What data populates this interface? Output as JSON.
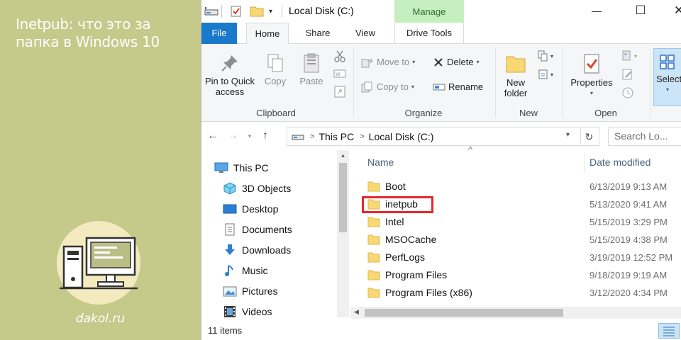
{
  "promo": {
    "title": "Inetpub: что это за папка в Windows 10",
    "site": "dakol.ru"
  },
  "window": {
    "title": "Local Disk (C:)",
    "context_tab": "Manage",
    "controls": {
      "minimize": "—",
      "maximize": "☐",
      "close": "✕"
    }
  },
  "tabs": [
    "File",
    "Home",
    "Share",
    "View",
    "Drive Tools"
  ],
  "ribbon": {
    "clipboard": {
      "label": "Clipboard",
      "pin": "Pin to Quick access",
      "copy": "Copy",
      "paste": "Paste"
    },
    "organize": {
      "label": "Organize",
      "move_to": "Move to",
      "copy_to": "Copy to",
      "delete": "Delete",
      "rename": "Rename"
    },
    "new": {
      "label": "New",
      "new_folder": "New folder"
    },
    "open": {
      "label": "Open",
      "properties": "Properties"
    },
    "select": {
      "select": "Select"
    }
  },
  "address": {
    "crumbs": [
      "This PC",
      "Local Disk (C:)"
    ],
    "search_placeholder": "Search Lo..."
  },
  "nav": [
    {
      "label": "This PC",
      "icon": "computer-icon"
    },
    {
      "label": "3D Objects",
      "icon": "cube-icon"
    },
    {
      "label": "Desktop",
      "icon": "desktop-icon"
    },
    {
      "label": "Documents",
      "icon": "document-icon"
    },
    {
      "label": "Downloads",
      "icon": "download-arrow-icon"
    },
    {
      "label": "Music",
      "icon": "music-note-icon"
    },
    {
      "label": "Pictures",
      "icon": "picture-icon"
    },
    {
      "label": "Videos",
      "icon": "film-icon"
    }
  ],
  "columns": {
    "name": "Name",
    "date": "Date modified"
  },
  "files": [
    {
      "name": "Boot",
      "date": "6/13/2019 9:13 AM"
    },
    {
      "name": "inetpub",
      "date": "5/13/2020 9:41 AM",
      "highlighted": true
    },
    {
      "name": "Intel",
      "date": "5/15/2019 3:29 PM"
    },
    {
      "name": "MSOCache",
      "date": "5/15/2019 4:38 PM"
    },
    {
      "name": "PerfLogs",
      "date": "3/19/2019 12:52 PM"
    },
    {
      "name": "Program Files",
      "date": "9/18/2019 9:19 AM"
    },
    {
      "name": "Program Files (x86)",
      "date": "3/12/2020 4:34 PM"
    }
  ],
  "status": {
    "items": "11 items"
  },
  "colors": {
    "promo_bg": "#c5c98a",
    "file_tab": "#1979ca",
    "manage_bg": "#c6efc0",
    "highlight": "#e8262b",
    "folder": "#f8d775"
  }
}
